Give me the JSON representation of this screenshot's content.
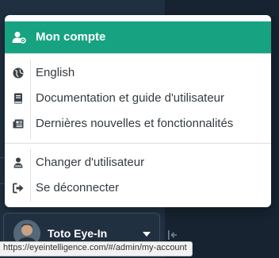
{
  "menu": {
    "header": {
      "label": "Mon compte",
      "icon": "user-gear-icon",
      "bg_color": "#17a381"
    },
    "items": [
      {
        "label": "English",
        "icon": "globe-icon"
      },
      {
        "label": "Documentation et guide d'utilisateur",
        "icon": "book-icon"
      },
      {
        "label": "Dernières nouvelles et fonctionnalités",
        "icon": "newspaper-icon"
      },
      {
        "label": "Changer d'utilisateur",
        "icon": "user-switch-icon"
      },
      {
        "label": "Se déconnecter",
        "icon": "sign-out-icon"
      }
    ]
  },
  "user": {
    "name": "Toto Eye-In"
  },
  "status": {
    "url": "https://eyeintelligence.com/#/admin/my-account"
  }
}
